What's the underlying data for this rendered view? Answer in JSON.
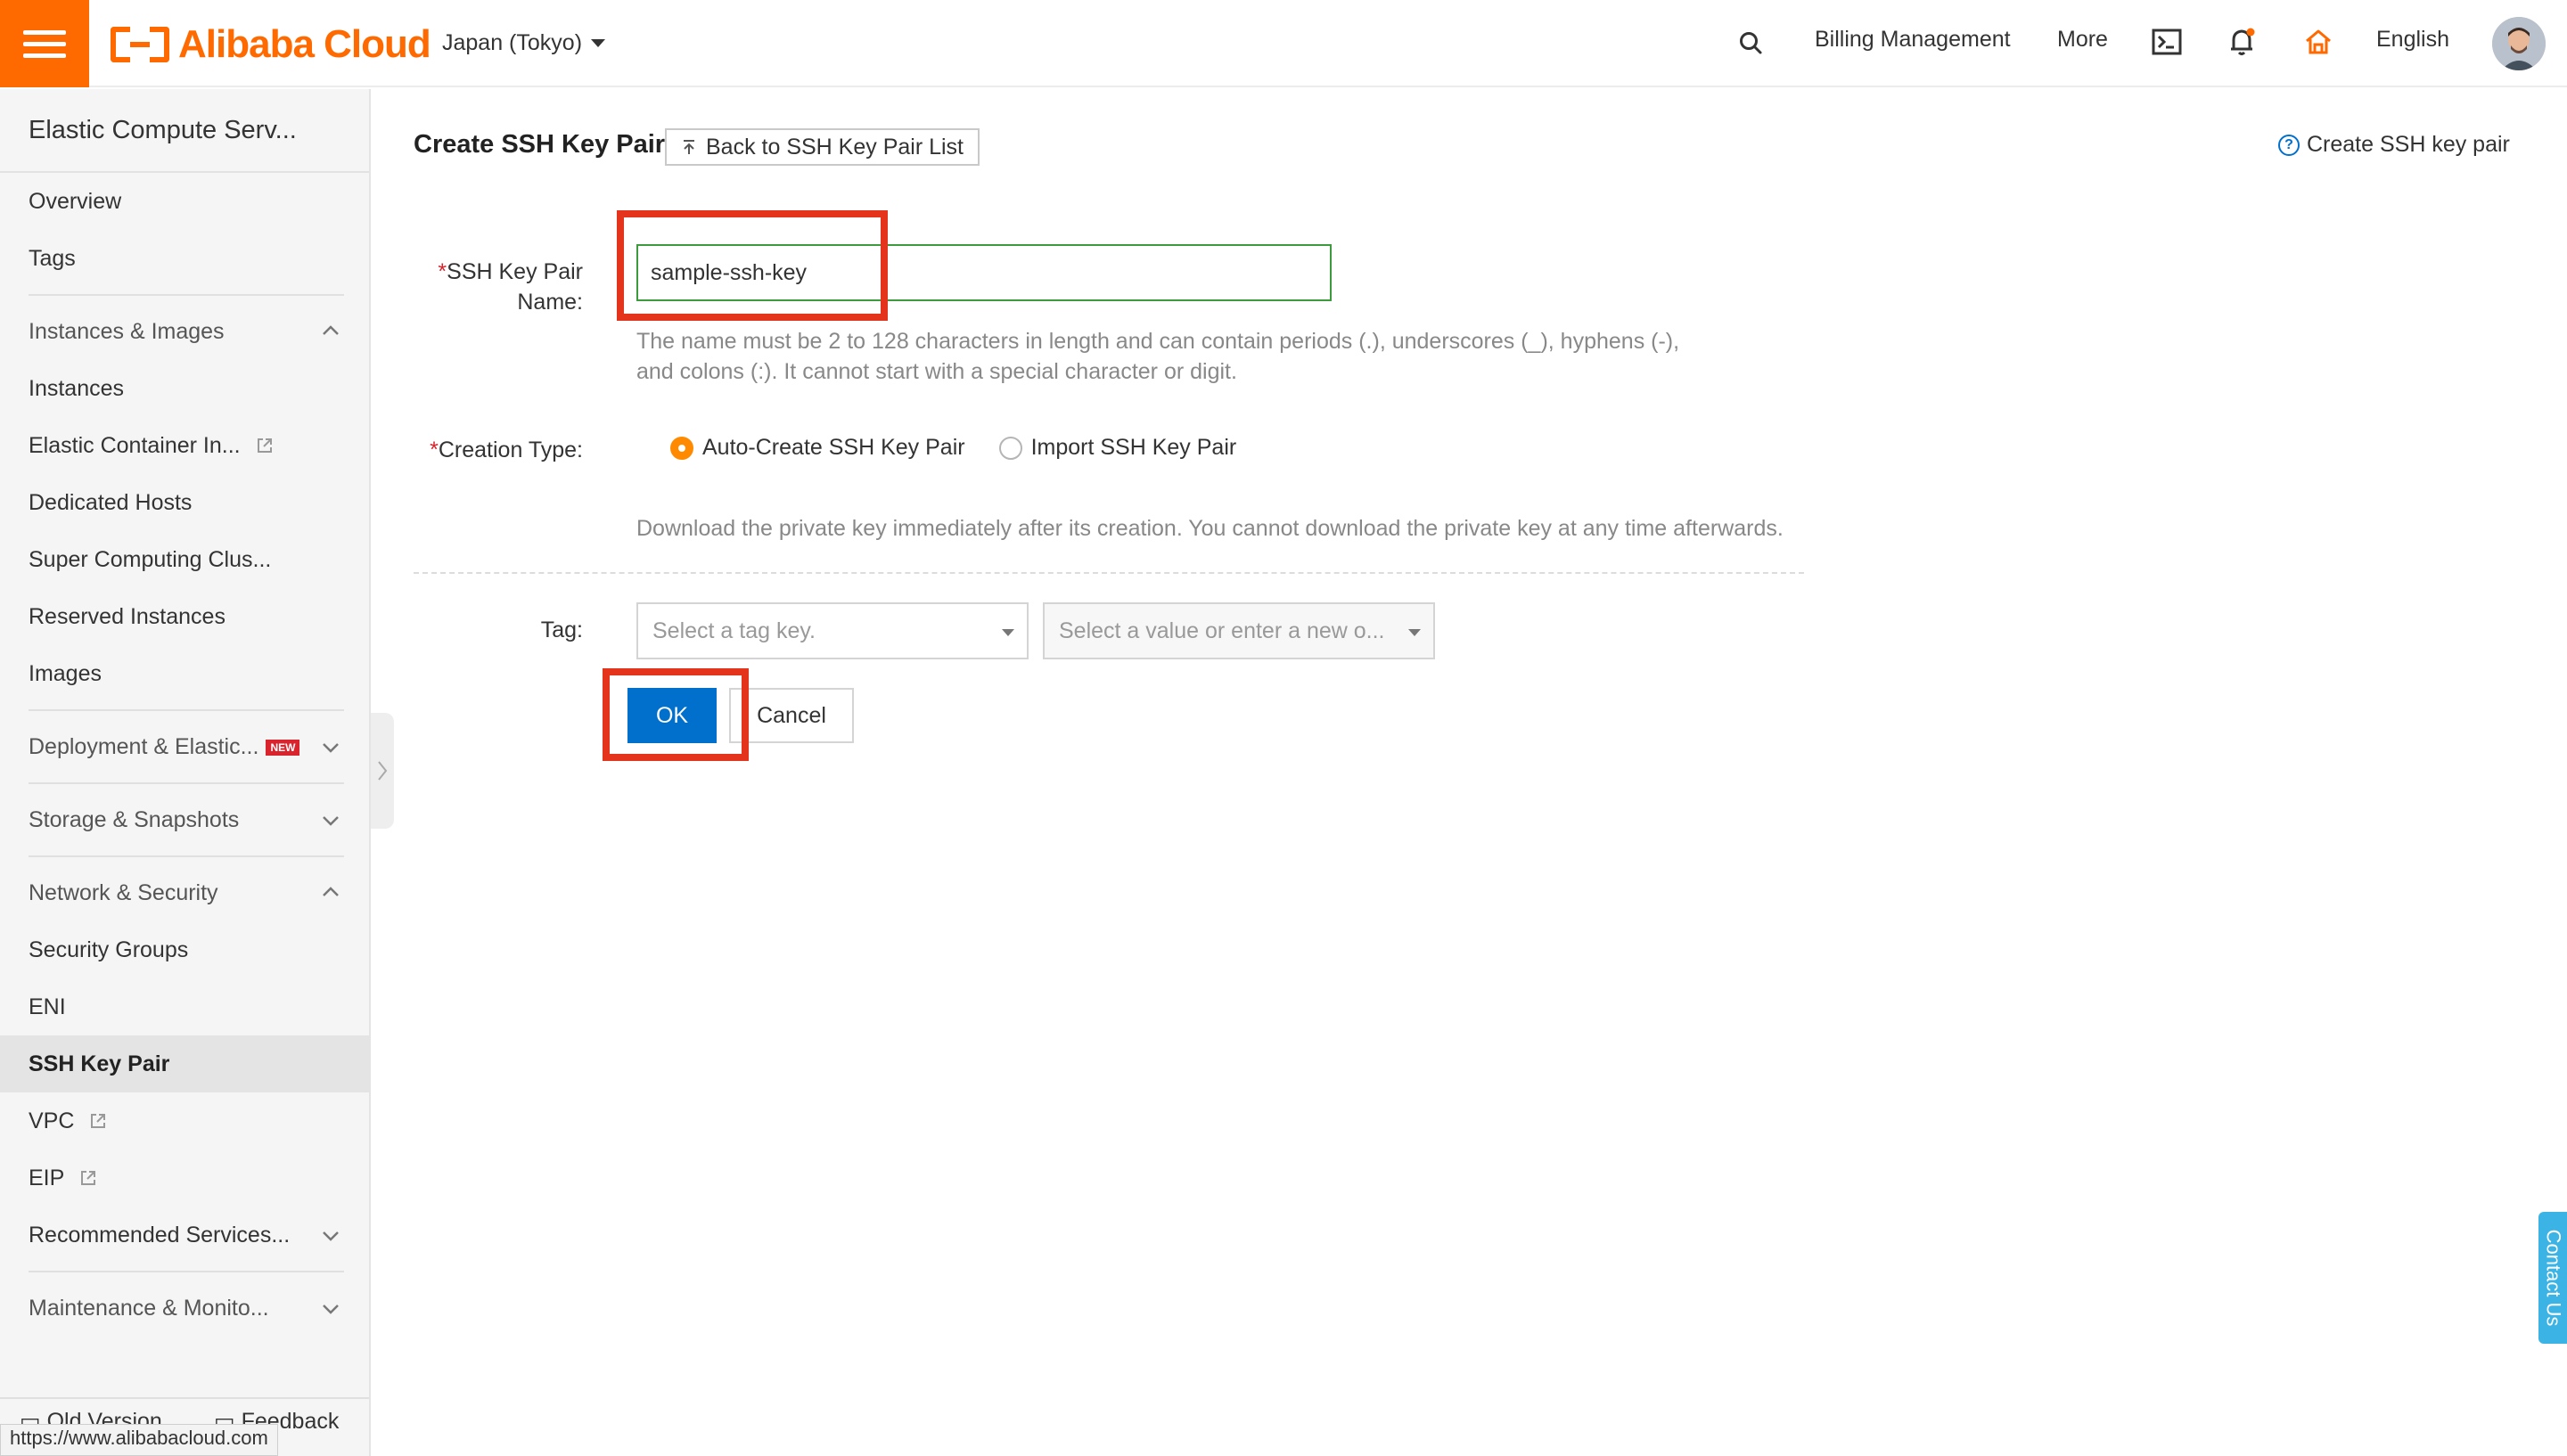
{
  "header": {
    "brand": "Alibaba Cloud",
    "region": "Japan (Tokyo)",
    "billing": "Billing Management",
    "more": "More",
    "language": "English"
  },
  "sidebar": {
    "title": "Elastic Compute Serv...",
    "items": [
      {
        "label": "Overview"
      },
      {
        "label": "Tags"
      },
      {
        "label": "Instances & Images"
      },
      {
        "label": "Instances"
      },
      {
        "label": "Elastic Container In..."
      },
      {
        "label": "Dedicated Hosts"
      },
      {
        "label": "Super Computing Clus..."
      },
      {
        "label": "Reserved Instances"
      },
      {
        "label": "Images"
      },
      {
        "label": "Deployment & Elastic...",
        "badge": "NEW"
      },
      {
        "label": "Storage & Snapshots"
      },
      {
        "label": "Network & Security"
      },
      {
        "label": "Security Groups"
      },
      {
        "label": "ENI"
      },
      {
        "label": "SSH Key Pair"
      },
      {
        "label": "VPC"
      },
      {
        "label": "EIP"
      },
      {
        "label": "Recommended Services..."
      },
      {
        "label": "Maintenance & Monito..."
      }
    ],
    "footer_old_version": "Old Version",
    "footer_feedback": "Feedback"
  },
  "main": {
    "title": "Create SSH Key Pair",
    "back_button": "Back to SSH Key Pair List",
    "help_link": "Create SSH key pair",
    "name_label_req": "*",
    "name_label": "SSH Key Pair Name:",
    "name_label_line1": "SSH Key Pair",
    "name_label_line2": "Name:",
    "name_value": "sample-ssh-key",
    "name_hint_line1": "The name must be 2 to 128 characters in length and can contain periods (.), underscores (_), hyphens (-),",
    "name_hint_line2": "and colons (:). It cannot start with a special character or digit.",
    "creation_type_req": "*",
    "creation_type_label": "Creation Type:",
    "creation_options": [
      "Auto-Create SSH Key Pair",
      "Import SSH Key Pair"
    ],
    "creation_selected": "Auto-Create SSH Key Pair",
    "creation_note": "Download the private key immediately after its creation. You cannot download the private key at any time afterwards.",
    "tag_label": "Tag:",
    "tag_key_placeholder": "Select a tag key.",
    "tag_value_placeholder": "Select a value or enter a new o...",
    "ok_button": "OK",
    "cancel_button": "Cancel"
  },
  "status_url": "https://www.alibabacloud.com",
  "contact_us": "Contact Us",
  "colors": {
    "brand_orange": "#ff6a00",
    "primary_blue": "#0070cc",
    "highlight_red": "#e5341c",
    "input_border_green": "#3d9a3d"
  }
}
